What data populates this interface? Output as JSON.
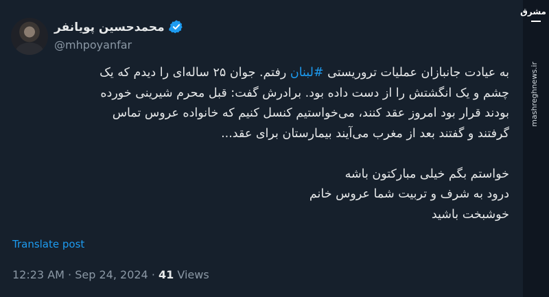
{
  "author": {
    "display_name": "محمدحسین پویانفر",
    "handle": "@mhpoyanfar",
    "verified_icon": "verified-badge-icon"
  },
  "post": {
    "line1_before": "به عیادت جانبازان عملیات تروریستی ",
    "hashtag": "#لبنان",
    "line1_after": " رفتم. جوان ۲۵ ساله‌ای را دیدم که یک",
    "line2": "چشم و یک انگشتش را از دست داده بود. برادرش گفت: قبل محرم شیرینی خورده",
    "line3": "بودند قرار بود امروز عقد کنند، می‌خواستیم کنسل کنیم که خانواده عروس تماس",
    "line4": "گرفتند و گفتند بعد از مغرب می‌آیند بیمارستان برای عقد...",
    "line5": "خواستم بگم خیلی مبارکتون باشه",
    "line6": "درود به شرف و تربیت شما عروس خانم",
    "line7": "خوشبخت باشید"
  },
  "translate_label": "Translate post",
  "meta": {
    "time": "12:23 AM",
    "separator": "·",
    "date": "Sep 24, 2024",
    "views_count": "41",
    "views_label": "Views"
  },
  "watermark": {
    "logo_text": "مشرق",
    "site": "mashreghnews.ir"
  },
  "colors": {
    "background": "#16202c",
    "link": "#1d9bf0",
    "muted": "#8b98a5",
    "text": "#e7e9ea"
  }
}
